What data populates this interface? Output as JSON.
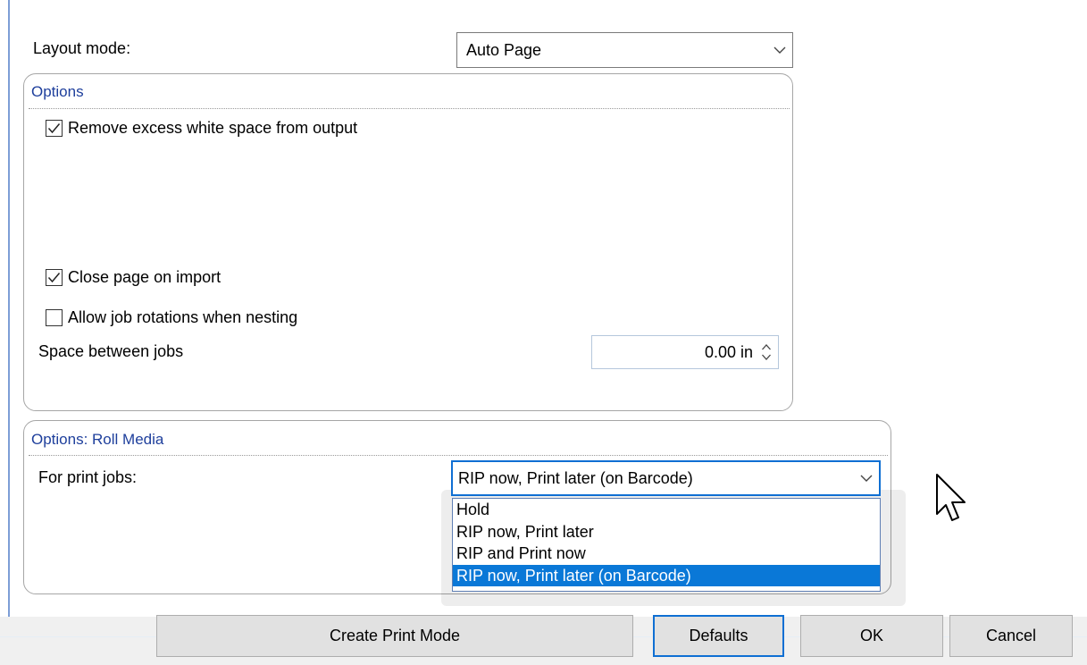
{
  "layout": {
    "label": "Layout mode:",
    "selected": "Auto Page"
  },
  "options": {
    "title": "Options",
    "remove_whitespace": {
      "label": "Remove excess white space from output",
      "checked": true
    },
    "close_page": {
      "label": "Close page on import",
      "checked": true
    },
    "allow_rotations": {
      "label": "Allow job rotations when nesting",
      "checked": false
    },
    "spacing": {
      "label": "Space between jobs",
      "value": "0.00 in"
    }
  },
  "roll_media": {
    "title": "Options: Roll Media",
    "print_jobs_label": "For print jobs:",
    "selected": "RIP now, Print later (on Barcode)",
    "dropdown_options": [
      "Hold",
      "RIP now, Print later",
      "RIP and Print now",
      "RIP now, Print later (on Barcode)"
    ],
    "highlighted_index": 3
  },
  "buttons": {
    "create_print_mode": "Create Print Mode",
    "defaults": "Defaults",
    "ok": "OK",
    "cancel": "Cancel"
  },
  "colors": {
    "group_title": "#1e3f9c",
    "selection": "#0a78d7",
    "focus_border": "#0f6fd3"
  },
  "icons": {
    "dropdown": "chevron-down-icon",
    "checkbox": "checkmark-icon",
    "spinner": "up-down-arrows-icon",
    "cursor": "mouse-pointer-icon"
  }
}
